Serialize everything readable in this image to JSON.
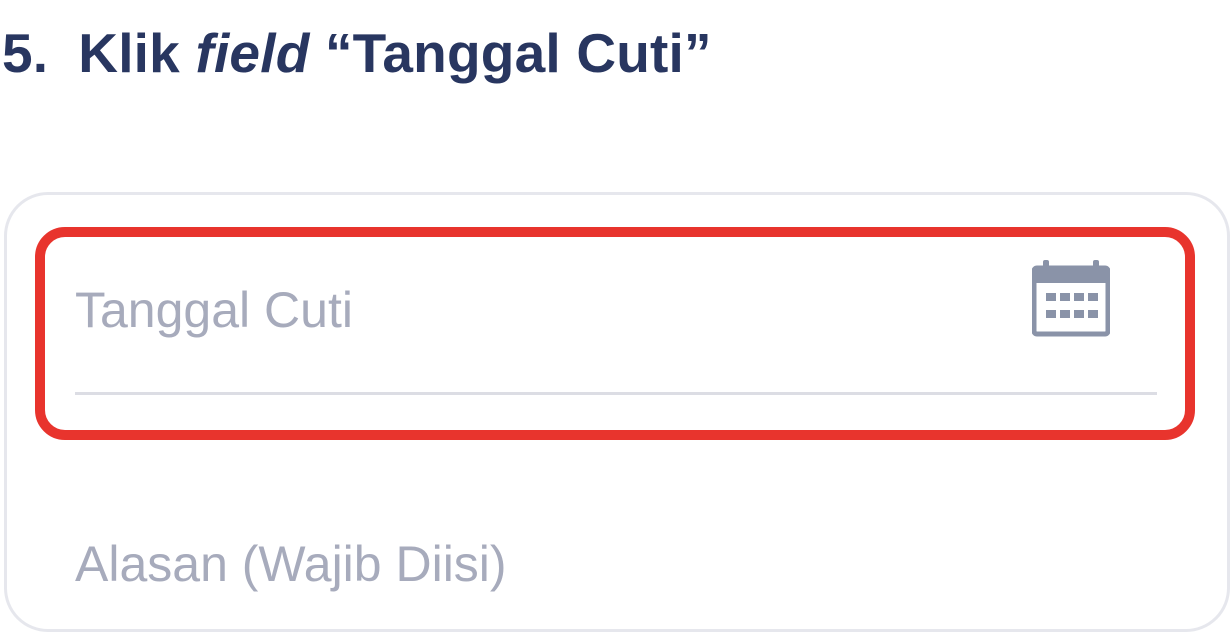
{
  "instruction": {
    "number": "5.",
    "prefix": "Klik",
    "emphasis": "field",
    "target": "“Tanggal Cuti”"
  },
  "form": {
    "date_field": {
      "placeholder": "Tanggal Cuti",
      "icon": "calendar-icon"
    },
    "reason_field": {
      "placeholder": "Alasan (Wajib Diisi)"
    }
  },
  "colors": {
    "title": "#283660",
    "highlight": "#e8342d",
    "placeholder": "#a7abbc",
    "icon": "#8a93a8",
    "card_border": "#e6e7ed",
    "field_underline": "#dcdde4"
  }
}
